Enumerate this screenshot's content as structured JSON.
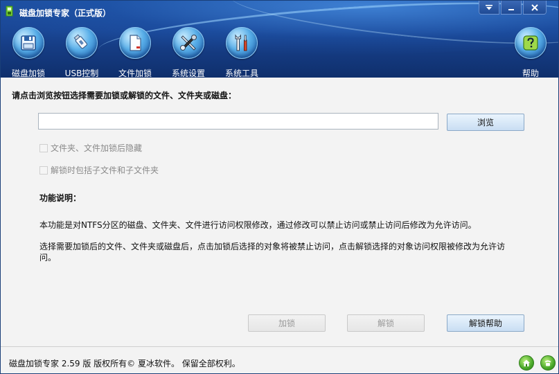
{
  "window": {
    "title": "磁盘加锁专家（正式版）"
  },
  "toolbar": {
    "items": [
      {
        "label": "磁盘加锁",
        "icon": "floppy-disk-icon"
      },
      {
        "label": "USB控制",
        "icon": "usb-drive-icon"
      },
      {
        "label": "文件加锁",
        "icon": "document-icon"
      },
      {
        "label": "系统设置",
        "icon": "tools-icon"
      },
      {
        "label": "系统工具",
        "icon": "wrench-icon"
      }
    ],
    "help_label": "帮助",
    "help_icon": "question-mark-icon"
  },
  "main": {
    "instruction": "请点击浏览按钮选择需要加锁或解锁的文件、文件夹或磁盘：",
    "path_value": "",
    "browse_label": "浏览",
    "options": [
      {
        "label": "文件夹、文件加锁后隐藏",
        "checked": false,
        "enabled": false
      },
      {
        "label": "解锁时包括子文件和子文件夹",
        "checked": false,
        "enabled": false
      }
    ],
    "section_title": "功能说明：",
    "paragraphs": [
      "本功能是对NTFS分区的磁盘、文件夹、文件进行访问权限修改，通过修改可以禁止访问或禁止访问后修改为允许访问。",
      "选择需要加锁后的文件、文件夹或磁盘后，点击加锁后选择的对象将被禁止访问，点击解锁选择的对象访问权限被修改为允许访问。"
    ],
    "lock_label": "加锁",
    "unlock_label": "解锁",
    "unlock_help_label": "解锁帮助"
  },
  "footer": {
    "copyright": "磁盘加锁专家 2.59 版   版权所有© 夏冰软件。 保留全部权利。",
    "icons": [
      "home-icon",
      "phone-icon"
    ]
  },
  "colors": {
    "header_blue": "#1a4796",
    "accent_green": "#4aa82a"
  }
}
